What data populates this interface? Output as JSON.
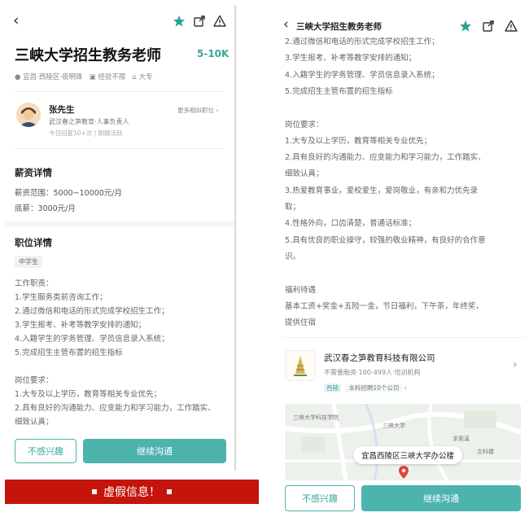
{
  "left": {
    "title": "三峡大学招生教务老师",
    "salary": "5-10K",
    "meta": {
      "location": "宜昌·西陵区·夜明珠",
      "experience": "经验不限",
      "education": "大专"
    },
    "recruiter": {
      "name": "张先生",
      "org_role": "武汉春之笋教育·人事负责人",
      "activity": "今日回复10+次  |  刚刚活跃",
      "more": "更多相似职位"
    },
    "salary_section": {
      "heading": "薪资详情",
      "range": "薪资范围：5000~10000元/月",
      "base": "底薪：3000元/月"
    },
    "job_section": {
      "heading": "职位详情",
      "tag": "中学生",
      "lines": [
        "工作职责：",
        "1.学生服务类前咨询工作；",
        "2.通过微信和电话的形式完成学校招生工作；",
        "3.学生报考、补考等教学安排的通知；",
        "4.入籍学生的学务管理、学员信息录入系统；",
        "5.完成招生主管布置的招生指标",
        "",
        "岗位要求：",
        "1.大专及以上学历，教育等相关专业优先；",
        "2.具有良好的沟通能力、应变能力和学习能力，工作踏实、",
        "细致认真；"
      ]
    },
    "buttons": {
      "not_interested": "不感兴趣",
      "continue": "继续沟通"
    }
  },
  "banner": {
    "text": "虚假信息！"
  },
  "right": {
    "title": "三峡大学招生教务老师",
    "body_lines": [
      "2.通过微信和电话的形式完成学校招生工作；",
      "3.学生报考、补考等教学安排的通知；",
      "4.入籍学生的学务管理、学员信息录入系统；",
      "5.完成招生主管布置的招生指标",
      "",
      "岗位要求：",
      "1.大专及以上学历，教育等相关专业优先；",
      "2.具有良好的沟通能力、应变能力和学习能力，工作踏实、",
      "细致认真；",
      "3.热爱教育事业，爱校爱生，爱岗敬业，有亲和力优先录",
      "取；",
      "4.性格外向，口齿清楚，普通话标准；",
      "5.具有优良的职业操守，较强的敬业精神，有良好的合作意",
      "识。",
      "",
      "福利待遇",
      "基本工资+奖金+五险一金，节日福利，下午茶，年终奖，",
      "提供住宿"
    ],
    "company": {
      "name": "武汉春之笋教育科技有限公司",
      "info": "不需要融资·100-499人·培训机构",
      "badge": "西陵",
      "badge_text": "本科招聘10个公司"
    },
    "map": {
      "address": "宜昌西陵区三峡大学办公楼",
      "labels": [
        "三峡大学科技学院",
        "三峡大学",
        "求索溪",
        "文科楼"
      ]
    },
    "buttons": {
      "not_interested": "不感兴趣",
      "continue": "继续沟通"
    }
  },
  "colors": {
    "accent": "#4db3ad",
    "salary": "#3aa69f",
    "banner": "#c4140c",
    "star": "#2aa29c"
  }
}
